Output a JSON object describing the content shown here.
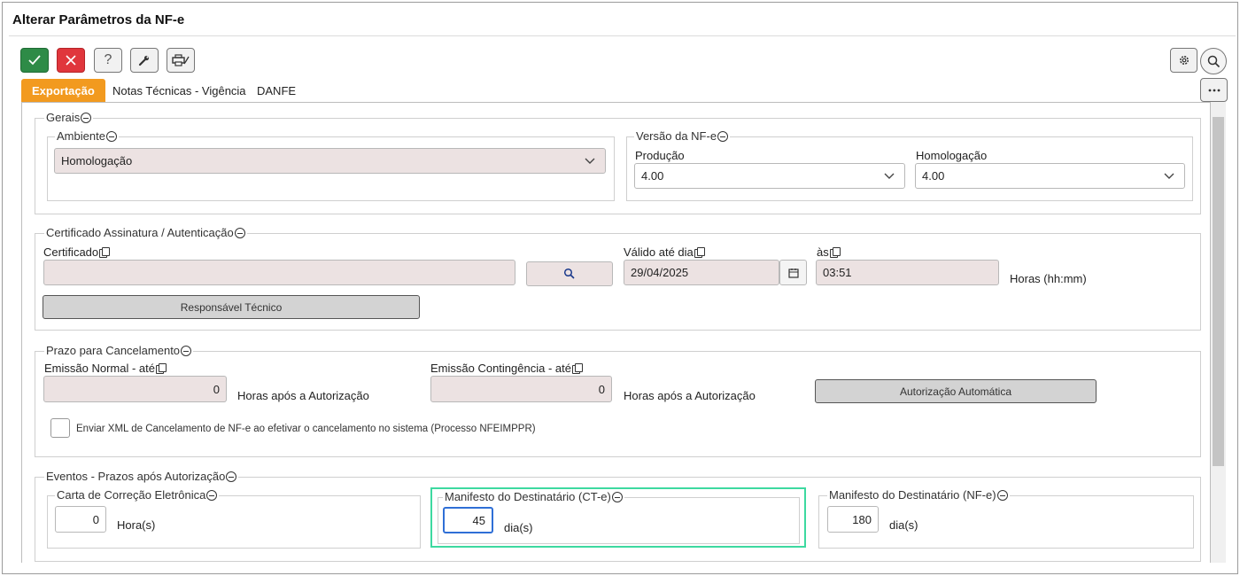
{
  "window": {
    "title": "Alterar Parâmetros da NF-e"
  },
  "toolbar": {
    "ok_icon": "check-icon",
    "cancel_icon": "close-icon",
    "help_label": "?",
    "tools_icon": "wrench-icon",
    "print_icon": "printer-icon",
    "settings_icon": "gear-icon",
    "search_icon": "search-icon",
    "more_icon": "ellipsis-icon"
  },
  "tabs": [
    {
      "label": "Exportação",
      "active": true
    },
    {
      "label": "Notas Técnicas - Vigência",
      "active": false
    },
    {
      "label": "DANFE",
      "active": false
    }
  ],
  "gerais": {
    "legend": "Gerais",
    "ambiente": {
      "legend": "Ambiente",
      "value": "Homologação"
    },
    "versao": {
      "legend": "Versão da NF-e",
      "producao_label": "Produção",
      "producao_value": "4.00",
      "homologacao_label": "Homologação",
      "homologacao_value": "4.00"
    }
  },
  "certificado": {
    "legend": "Certificado Assinatura / Autenticação",
    "certificado_label": "Certificado",
    "certificado_value": "",
    "valido_label": "Válido até dia",
    "valido_value": "29/04/2025",
    "as_label": "às",
    "as_value": "03:51",
    "horas_label": "Horas (hh:mm)",
    "responsavel_button": "Responsável Técnico"
  },
  "prazo": {
    "legend": "Prazo para Cancelamento",
    "normal_label": "Emissão Normal - até",
    "normal_value": "0",
    "normal_suffix": "Horas após a Autorização",
    "contingencia_label": "Emissão Contingência - até",
    "contingencia_value": "0",
    "contingencia_suffix": "Horas após a Autorização",
    "auto_button": "Autorização Automática",
    "enviar_xml_label": "Enviar XML de Cancelamento de NF-e ao efetivar o cancelamento no sistema (Processo NFEIMPPR)"
  },
  "eventos": {
    "legend": "Eventos - Prazos após Autorização",
    "carta": {
      "legend": "Carta de Correção Eletrônica",
      "value": "0",
      "suffix": "Hora(s)"
    },
    "manifesto_cte": {
      "legend": "Manifesto do Destinatário (CT-e)",
      "value": "45",
      "suffix": "dia(s)"
    },
    "manifesto_nfe": {
      "legend": "Manifesto do Destinatário (NF-e)",
      "value": "180",
      "suffix": "dia(s)"
    }
  },
  "colors": {
    "accent": "#f29a1f",
    "ok": "#2e8b47",
    "cancel": "#e0363c",
    "focus": "#3dd9a0",
    "input_bg": "#ece2e2"
  }
}
